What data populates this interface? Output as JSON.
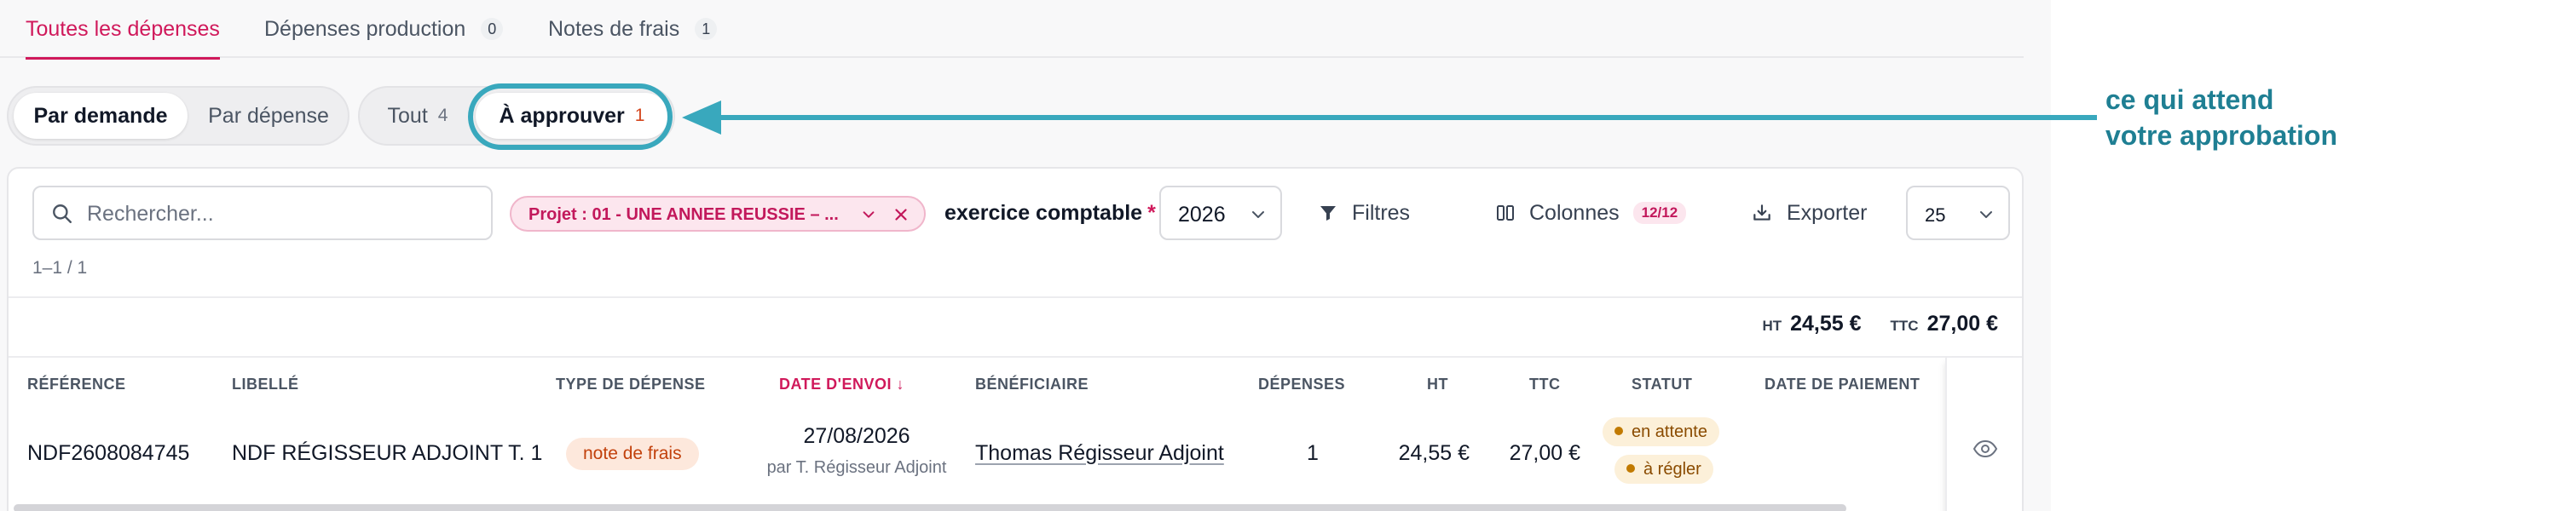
{
  "tabs": [
    {
      "label": "Toutes les dépenses",
      "count": null,
      "active": true
    },
    {
      "label": "Dépenses production",
      "count": "0",
      "active": false
    },
    {
      "label": "Notes de frais",
      "count": "1",
      "active": false
    }
  ],
  "view_toggle": {
    "by_request": "Par demande",
    "by_expense": "Par dépense",
    "selected": "Par demande"
  },
  "status_toggle": {
    "all_label": "Tout",
    "all_count": "4",
    "to_approve_label": "À approuver",
    "to_approve_count": "1",
    "selected": "À approuver"
  },
  "toolbar": {
    "search_placeholder": "Rechercher...",
    "filter_chip": "Projet : 01 - UNE ANNEE REUSSIE – ...",
    "fiscal_year_label": "exercice comptable",
    "fiscal_year_required": "*",
    "fiscal_year_value": "2026",
    "filters_label": "Filtres",
    "columns_label": "Colonnes",
    "columns_badge": "12/12",
    "export_label": "Exporter",
    "page_size": "25"
  },
  "pagination": "1–1 / 1",
  "totals": {
    "ht_label": "HT",
    "ht_value": "24,55 €",
    "ttc_label": "TTC",
    "ttc_value": "27,00 €"
  },
  "table": {
    "headers": {
      "reference": "RÉFÉRENCE",
      "label": "LIBELLÉ",
      "type": "TYPE DE DÉPENSE",
      "sent_date": "DATE D'ENVOI ↓",
      "beneficiary": "BÉNÉFICIAIRE",
      "expenses": "DÉPENSES",
      "ht": "HT",
      "ttc": "TTC",
      "status": "STATUT",
      "payment_date": "DATE DE PAIEMENT"
    },
    "rows": [
      {
        "reference": "NDF2608084745",
        "label": "NDF RÉGISSEUR ADJOINT T. 1",
        "type": "note de frais",
        "sent_date": "27/08/2026",
        "sent_by": "par T. Régisseur Adjoint",
        "beneficiary": "Thomas Régisseur Adjoint",
        "expenses": "1",
        "ht": "24,55 €",
        "ttc": "27,00 €",
        "status_1": "en attente",
        "status_2": "à régler",
        "payment_date": ""
      }
    ]
  },
  "annotation": {
    "line_1": "ce qui attend",
    "line_2": "votre approbation"
  },
  "colors": {
    "accent": "#d0195b",
    "highlight": "#39a8bd",
    "annotation_text": "#1f7f93"
  }
}
